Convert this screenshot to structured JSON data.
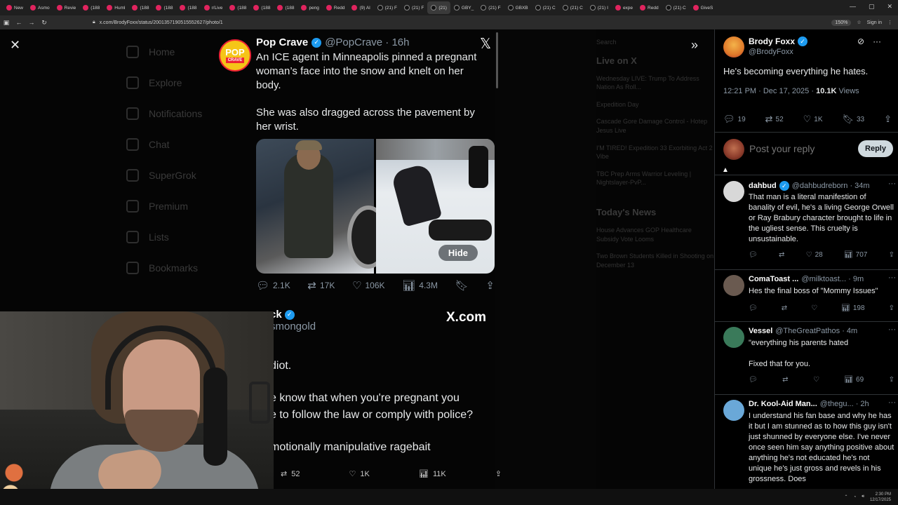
{
  "browser": {
    "tabs": [
      "New",
      "Asmo",
      "Revie",
      "(188",
      "Huml",
      "(188",
      "(188",
      "(188",
      "r/Live",
      "(188",
      "(188",
      "(188",
      "peng",
      "Redd",
      "(9) Al",
      "(21) F",
      "(21) F",
      "(21)",
      "GBY_",
      "(21) F",
      "GBXB",
      "(21) C",
      "(21) C",
      "(21) I",
      "expe",
      "Redd",
      "(21) C",
      "GiveS"
    ],
    "url": "x.com/BrodyFoxx/status/2001357190515552627/photo/1",
    "zoom": "150%",
    "sign_in": "Sign in"
  },
  "background": {
    "nav": [
      "Home",
      "Explore",
      "Notifications",
      "Chat",
      "SuperGrok",
      "Premium",
      "Lists",
      "Bookmarks"
    ],
    "search": "Search",
    "live_heading": "Live on X",
    "live_items": [
      "Wednesday LIVE: Trump To Address Nation As Roll...",
      "Expedition Day",
      "Cascade Gore Damage Control - Hotep Jesus Live",
      "I'M TIRED! Expedition 33 Exorbiting Act 2 Vibe",
      "TBC Prep Arms Warrior Leveling | Nightslayer-PvP..."
    ],
    "news_heading": "Today's News",
    "news_items": [
      "House Advances GOP Healthcare Subsidy Vote Looms",
      "Two Brown Students Killed in Shooting on December 13"
    ]
  },
  "main_tweet": {
    "name": "Pop Crave",
    "handle": "@PopCrave · 16h",
    "avatar_top": "POP",
    "avatar_bottom": "CRAVE",
    "para1": "An ICE agent in Minneapolis pinned a pregnant woman’s face into the snow and knelt on her body.",
    "para2": "She was also dragged across the pavement by her wrist.",
    "hide_label": "Hide",
    "replies": "2.1K",
    "reposts": "17K",
    "likes": "106K",
    "views": "4.3M"
  },
  "quote_tweet": {
    "name": "ck",
    "handle": "smongold",
    "brand": "X.com",
    "lines": [
      "diot.",
      "e know that when you're pregnant you",
      "e to follow the law or comply with police?",
      "motionally manipulative ragebait"
    ],
    "reposts": "52",
    "likes": "1K",
    "views": "11K"
  },
  "right_panel": {
    "op_name": "Brody Foxx",
    "op_handle": "@BrodyFoxx",
    "op_text": "He's becoming everything he hates.",
    "op_time": "12:21 PM · Dec 17, 2025 ·",
    "op_views_count": "10.1K",
    "op_views_label": "Views",
    "op_replies": "19",
    "op_reposts": "52",
    "op_likes": "1K",
    "op_bookmarks": "33",
    "compose_placeholder": "Post your reply",
    "reply_button": "Reply",
    "replies": [
      {
        "name": "dahbud",
        "handle": "@dahbudreborn · 34m",
        "text": "That man is a literal manifestion of banality of evil, he's a living George Orwell or Ray Brabury character brought to life in the ugliest sense. This cruelty is unsustainable.",
        "likes": "28",
        "views": "707",
        "avatar_color": "#d8d8d8"
      },
      {
        "name": "ComaToast ...",
        "handle": "@milktoast... · 9m",
        "text": "Hes the final boss of \"Mommy Issues\"",
        "likes": "",
        "views": "198",
        "avatar_color": "#6a5a50"
      },
      {
        "name": "Vessel",
        "handle": "@TheGreatPathos · 4m",
        "text": "\"everything his parents hated",
        "text2": "Fixed that for you.",
        "likes": "",
        "views": "69",
        "avatar_color": "#3a7a5a"
      },
      {
        "name": "Dr. Kool-Aid Man...",
        "handle": "@thegu... · 2h",
        "text": "I understand his fan base and why he has it but I am stunned as to how this guy isn't just shunned by everyone else. I've never once seen him say anything positive about anything he's not educated he's not unique he's just gross and revels in his grossness. Does",
        "avatar_color": "#6aa8d8"
      }
    ]
  },
  "taskbar": {
    "time": "2:30 PM",
    "date": "12/17/2025"
  }
}
